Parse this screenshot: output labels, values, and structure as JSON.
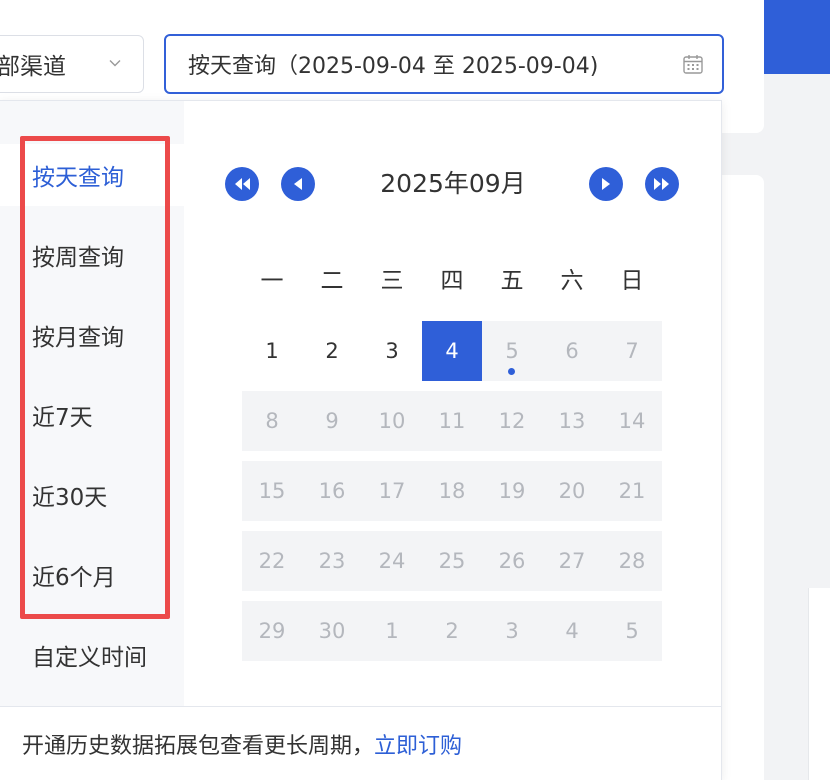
{
  "channel_select": {
    "value": "部渠道"
  },
  "date_input": {
    "value": "按天查询（2025-09-04 至 2025-09-04)"
  },
  "sidebar": {
    "items": [
      {
        "label": "按天查询",
        "active": true
      },
      {
        "label": "按周查询"
      },
      {
        "label": "按月查询"
      },
      {
        "label": "近7天"
      },
      {
        "label": "近30天"
      },
      {
        "label": "近6个月"
      },
      {
        "label": "自定义时间"
      }
    ]
  },
  "calendar": {
    "month_title": "2025年09月",
    "weekdays": [
      "一",
      "二",
      "三",
      "四",
      "五",
      "六",
      "日"
    ],
    "weeks": [
      [
        "1",
        "2",
        "3",
        "4",
        "5",
        "6",
        "7"
      ],
      [
        "8",
        "9",
        "10",
        "11",
        "12",
        "13",
        "14"
      ],
      [
        "15",
        "16",
        "17",
        "18",
        "19",
        "20",
        "21"
      ],
      [
        "22",
        "23",
        "24",
        "25",
        "26",
        "27",
        "28"
      ],
      [
        "29",
        "30",
        "1",
        "2",
        "3",
        "4",
        "5"
      ]
    ],
    "selected_day": "4",
    "today_marker_day": "5"
  },
  "footer": {
    "text": "开通历史数据拓展包查看更长周期，",
    "link": "立即订购"
  },
  "colors": {
    "accent": "#2f5fd8",
    "highlight_border": "#ec4a4a"
  }
}
